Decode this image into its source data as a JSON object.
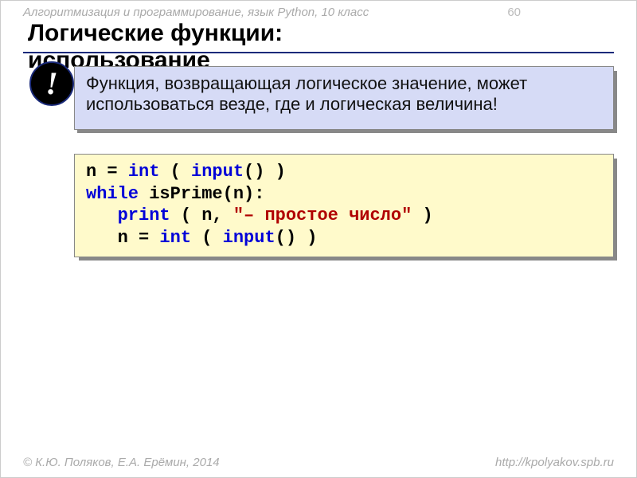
{
  "header": "Алгоритмизация и программирование, язык Python, 10 класс",
  "page_number": "60",
  "title_line1": "Логические функции:",
  "title_line2": "использование",
  "bang": "!",
  "callout": "Функция, возвращающая логическое значение, может использоваться везде, где и логическая величина!",
  "code": {
    "l1a": "n = ",
    "l1b": "int",
    "l1c": " ( ",
    "l1d": "input",
    "l1e": "() )",
    "l2a": "while",
    "l2b": " isPrime(n):",
    "l3a": "   ",
    "l3b": "print",
    "l3c": " ( n, ",
    "l3d": "\"– простое число\"",
    "l3e": " )",
    "l4a": "   n = ",
    "l4b": "int",
    "l4c": " ( ",
    "l4d": "input",
    "l4e": "() )"
  },
  "footer_left": "© К.Ю. Поляков, Е.А. Ерёмин, 2014",
  "footer_right": "http://kpolyakov.spb.ru"
}
